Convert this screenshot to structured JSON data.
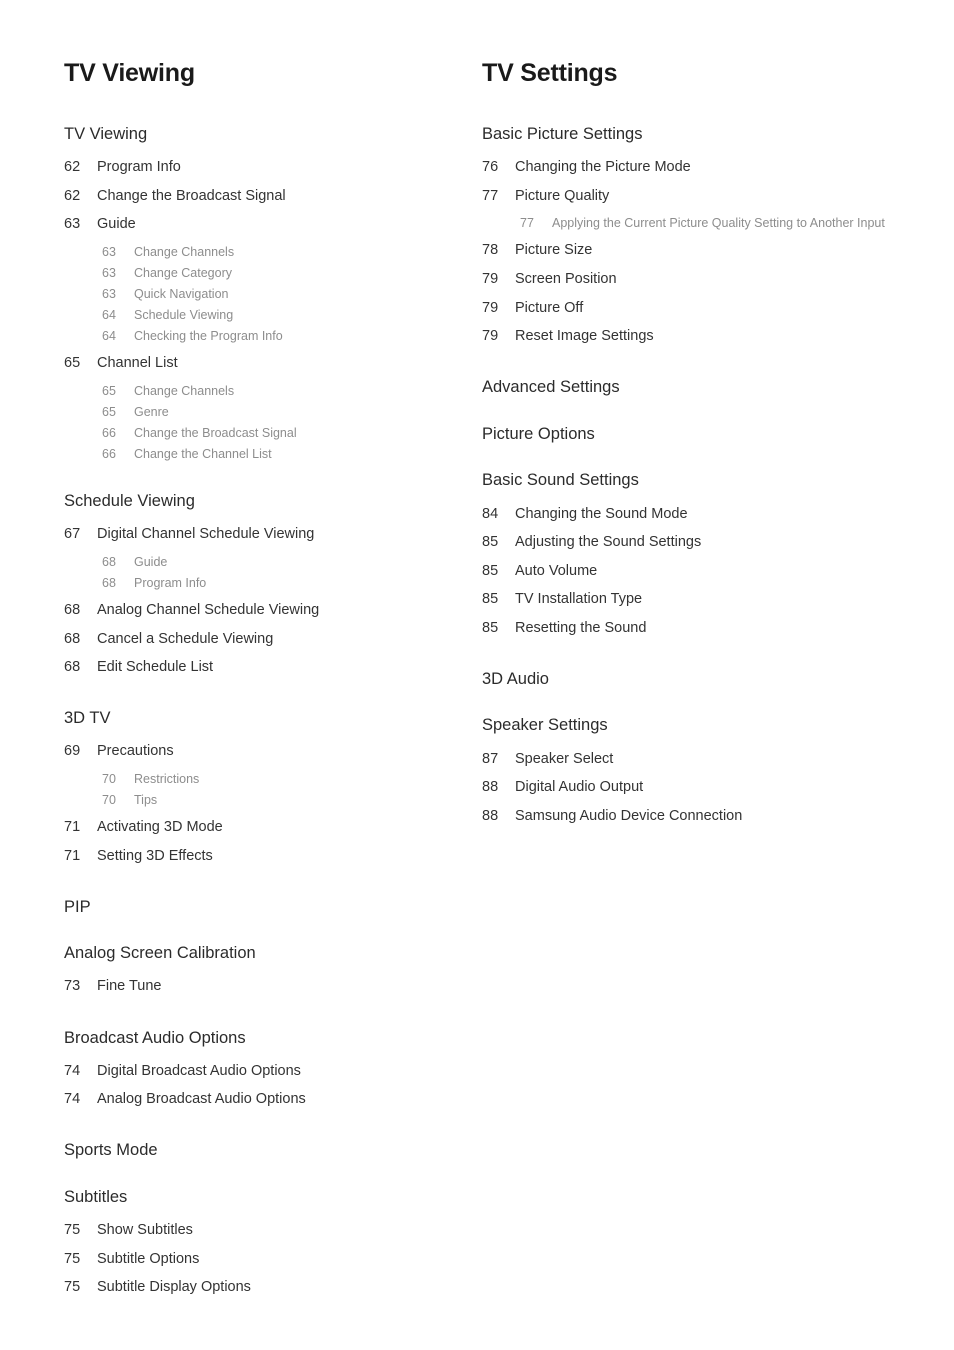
{
  "columns": [
    {
      "title": "TV Viewing",
      "sections": [
        {
          "heading": "TV Viewing",
          "entries": [
            {
              "page": "62",
              "label": "Program Info"
            },
            {
              "page": "62",
              "label": "Change the Broadcast Signal"
            },
            {
              "page": "63",
              "label": "Guide",
              "children": [
                {
                  "page": "63",
                  "label": "Change Channels"
                },
                {
                  "page": "63",
                  "label": "Change Category"
                },
                {
                  "page": "63",
                  "label": "Quick Navigation"
                },
                {
                  "page": "64",
                  "label": "Schedule Viewing"
                },
                {
                  "page": "64",
                  "label": "Checking the Program Info"
                }
              ]
            },
            {
              "page": "65",
              "label": "Channel List",
              "children": [
                {
                  "page": "65",
                  "label": "Change Channels"
                },
                {
                  "page": "65",
                  "label": "Genre"
                },
                {
                  "page": "66",
                  "label": "Change the Broadcast Signal"
                },
                {
                  "page": "66",
                  "label": "Change the Channel List"
                }
              ]
            }
          ]
        },
        {
          "heading": "Schedule Viewing",
          "entries": [
            {
              "page": "67",
              "label": "Digital Channel Schedule Viewing",
              "children": [
                {
                  "page": "68",
                  "label": "Guide"
                },
                {
                  "page": "68",
                  "label": "Program Info"
                }
              ]
            },
            {
              "page": "68",
              "label": "Analog Channel Schedule Viewing"
            },
            {
              "page": "68",
              "label": "Cancel a Schedule Viewing"
            },
            {
              "page": "68",
              "label": "Edit Schedule List"
            }
          ]
        },
        {
          "heading": "3D TV",
          "entries": [
            {
              "page": "69",
              "label": "Precautions",
              "children": [
                {
                  "page": "70",
                  "label": "Restrictions"
                },
                {
                  "page": "70",
                  "label": "Tips"
                }
              ]
            },
            {
              "page": "71",
              "label": "Activating 3D Mode"
            },
            {
              "page": "71",
              "label": "Setting 3D Effects"
            }
          ]
        },
        {
          "heading": "PIP",
          "entries": []
        },
        {
          "heading": "Analog Screen Calibration",
          "entries": [
            {
              "page": "73",
              "label": "Fine Tune"
            }
          ]
        },
        {
          "heading": "Broadcast Audio Options",
          "entries": [
            {
              "page": "74",
              "label": "Digital Broadcast Audio Options"
            },
            {
              "page": "74",
              "label": "Analog Broadcast Audio Options"
            }
          ]
        },
        {
          "heading": "Sports Mode",
          "entries": []
        },
        {
          "heading": "Subtitles",
          "entries": [
            {
              "page": "75",
              "label": "Show Subtitles"
            },
            {
              "page": "75",
              "label": "Subtitle Options"
            },
            {
              "page": "75",
              "label": "Subtitle Display Options"
            }
          ]
        }
      ]
    },
    {
      "title": "TV Settings",
      "sections": [
        {
          "heading": "Basic Picture Settings",
          "entries": [
            {
              "page": "76",
              "label": "Changing the Picture Mode"
            },
            {
              "page": "77",
              "label": "Picture Quality",
              "children": [
                {
                  "page": "77",
                  "label": "Applying the Current Picture Quality Setting to Another Input"
                }
              ]
            },
            {
              "page": "78",
              "label": "Picture Size"
            },
            {
              "page": "79",
              "label": "Screen Position"
            },
            {
              "page": "79",
              "label": "Picture Off"
            },
            {
              "page": "79",
              "label": "Reset Image Settings"
            }
          ]
        },
        {
          "heading": "Advanced Settings",
          "entries": []
        },
        {
          "heading": "Picture Options",
          "entries": []
        },
        {
          "heading": "Basic Sound Settings",
          "entries": [
            {
              "page": "84",
              "label": "Changing the Sound Mode"
            },
            {
              "page": "85",
              "label": "Adjusting the Sound Settings"
            },
            {
              "page": "85",
              "label": "Auto Volume"
            },
            {
              "page": "85",
              "label": "TV Installation Type"
            },
            {
              "page": "85",
              "label": "Resetting the Sound"
            }
          ]
        },
        {
          "heading": "3D Audio",
          "entries": []
        },
        {
          "heading": "Speaker Settings",
          "entries": [
            {
              "page": "87",
              "label": "Speaker Select"
            },
            {
              "page": "88",
              "label": "Digital Audio Output"
            },
            {
              "page": "88",
              "label": "Samsung Audio Device Connection"
            }
          ]
        }
      ]
    }
  ]
}
